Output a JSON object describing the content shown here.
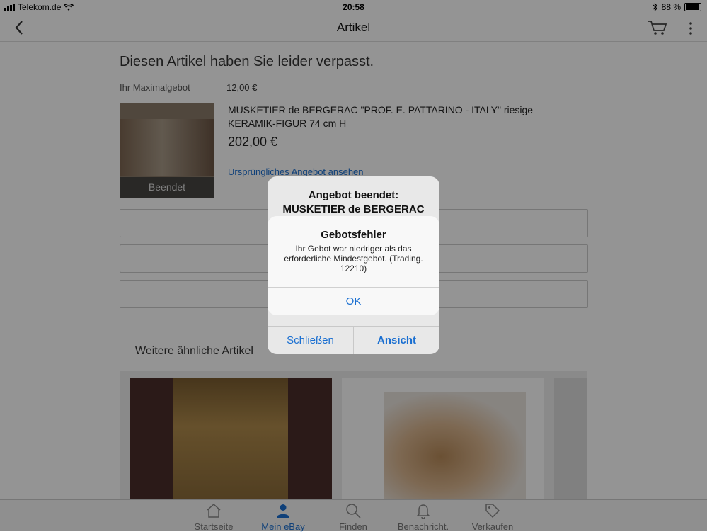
{
  "status_bar": {
    "carrier": "Telekom.de",
    "time": "20:58",
    "battery": "88 %",
    "battery_level": 0.88
  },
  "nav": {
    "title": "Artikel"
  },
  "page": {
    "headline": "Diesen Artikel haben Sie leider verpasst.",
    "max_bid_label": "Ihr Maximalgebot",
    "max_bid_value": "12,00 €",
    "thumb_badge": "Beendet",
    "item_title": "MUSKETIER de BERGERAC \"PROF. E. PATTARINO - ITALY\" riesige KERAMIK-FIGUR 74 cm H",
    "price": "202,00 €",
    "original_listing_link": "Ursprüngliches Angebot ansehen",
    "similar_heading": "Weitere ähnliche Artikel"
  },
  "tabs": [
    {
      "label": "Startseite",
      "icon": "home-icon",
      "active": false
    },
    {
      "label": "Mein eBay",
      "icon": "person-icon",
      "active": true
    },
    {
      "label": "Finden",
      "icon": "search-icon",
      "active": false
    },
    {
      "label": "Benachricht.",
      "icon": "bell-icon",
      "active": false
    },
    {
      "label": "Verkaufen",
      "icon": "tag-icon",
      "active": false
    }
  ],
  "alert_back": {
    "line1": "Angebot beendet:",
    "line2": "MUSKETIER de BERGERAC",
    "close_label": "Schließen",
    "view_label": "Ansicht"
  },
  "alert_front": {
    "title": "Gebotsfehler",
    "message": "Ihr Gebot war niedriger als das erforderliche Mindestgebot. (Trading. 12210)",
    "ok_label": "OK"
  },
  "colors": {
    "accent": "#1a6fd1",
    "dim_overlay": "rgba(0,0,0,0.42)"
  }
}
